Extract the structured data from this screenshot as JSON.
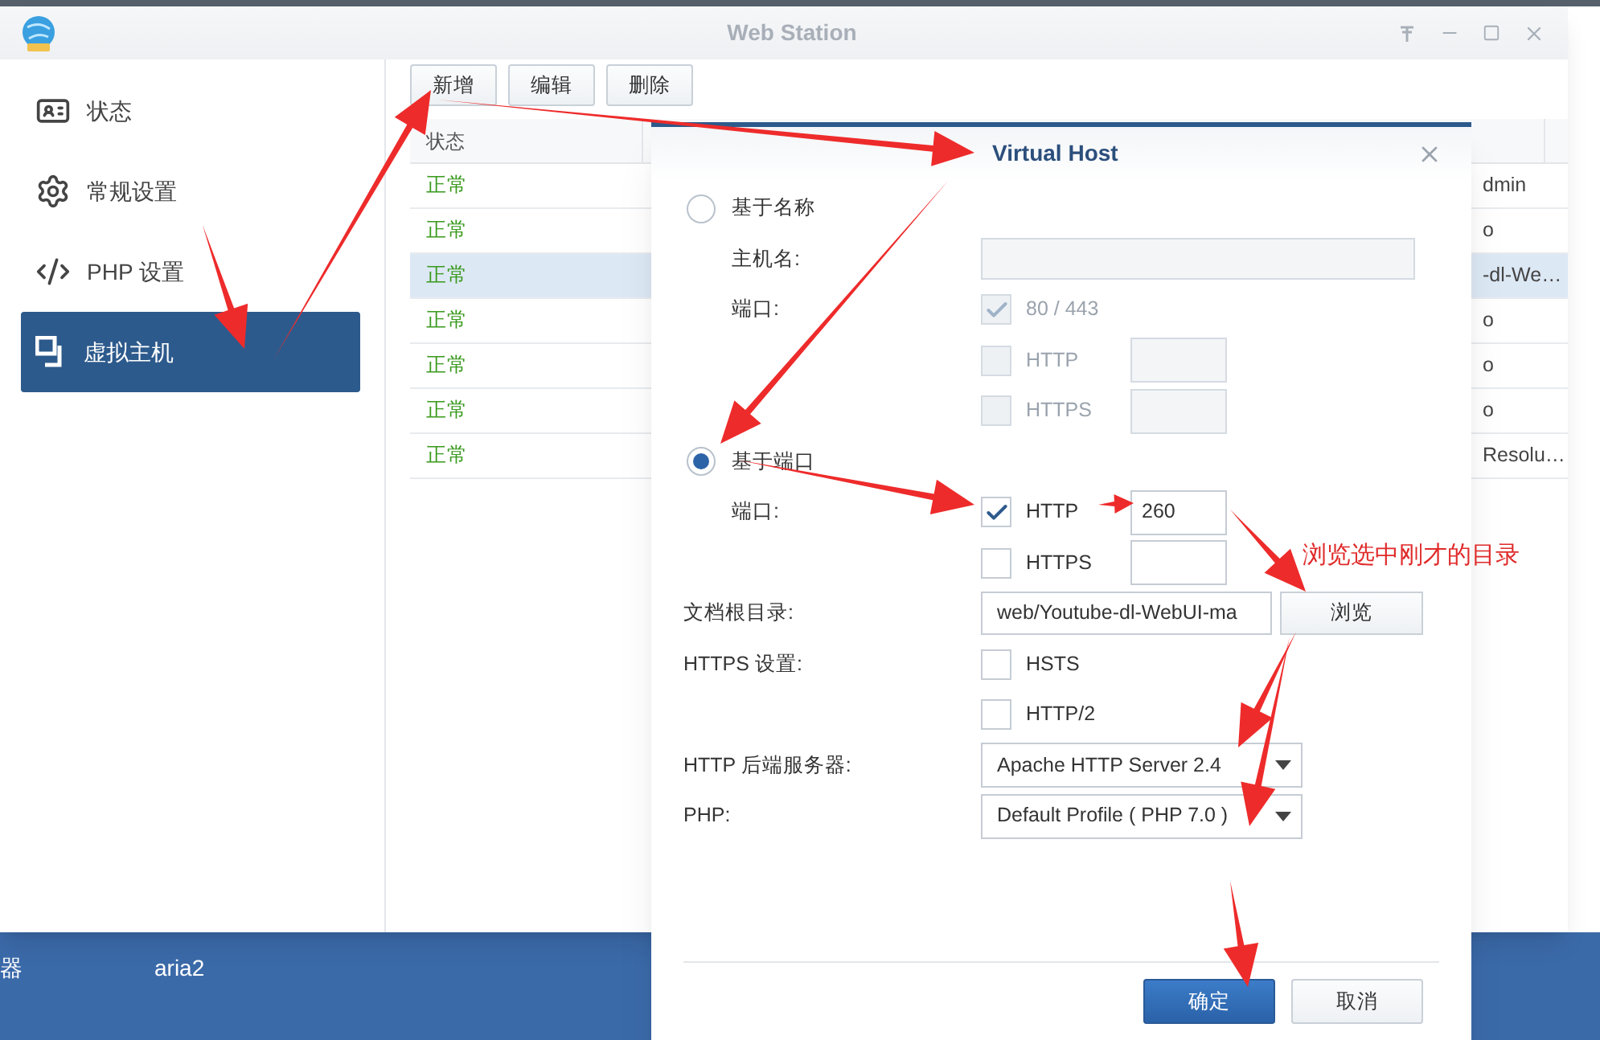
{
  "window": {
    "title": "Web Station"
  },
  "sidebar": {
    "items": [
      {
        "label": "状态",
        "kind": "status",
        "selected": false
      },
      {
        "label": "常规设置",
        "kind": "settings",
        "selected": false
      },
      {
        "label": "PHP 设置",
        "kind": "code",
        "selected": false
      },
      {
        "label": "虚拟主机",
        "kind": "hosts",
        "selected": true
      }
    ]
  },
  "toolbar": {
    "buttons": [
      "新增",
      "编辑",
      "删除"
    ]
  },
  "table": {
    "columns": [
      "状态"
    ],
    "rows": [
      {
        "status": "正常",
        "column_3": "dmin",
        "selected": false
      },
      {
        "status": "正常",
        "column_3": "o",
        "selected": false
      },
      {
        "status": "正常",
        "column_3": "-dl-We…",
        "selected": true
      },
      {
        "status": "正常",
        "column_3": "o",
        "selected": false
      },
      {
        "status": "正常",
        "column_3": "o",
        "selected": false
      },
      {
        "status": "正常",
        "column_3": "o",
        "selected": false
      },
      {
        "status": "正常",
        "column_3": "Resolu…",
        "selected": false
      }
    ]
  },
  "dialog": {
    "title": "Virtual Host",
    "name_based": {
      "label": "基于名称",
      "selected": false,
      "hostname_label": "主机名:",
      "port_label": "端口:",
      "default_port": {
        "label": "80 / 443",
        "checked": true
      },
      "http": {
        "label": "HTTP",
        "checked": false
      },
      "https": {
        "label": "HTTPS",
        "checked": false
      }
    },
    "port_based": {
      "label": "基于端口",
      "selected": true,
      "port_label": "端口:",
      "http": {
        "label": "HTTP",
        "checked": true,
        "value": "260"
      },
      "https": {
        "label": "HTTPS",
        "checked": false
      }
    },
    "document_root": {
      "label": "文档根目录:",
      "value": "web/Youtube-dl-WebUI-ma",
      "button": "浏览"
    },
    "https_settings": {
      "label": "HTTPS 设置:",
      "hsts": {
        "label": "HSTS",
        "checked": false
      },
      "http2": {
        "label": "HTTP/2",
        "checked": false
      }
    },
    "backend": {
      "label": "HTTP 后端服务器:",
      "value": "Apache HTTP Server 2.4"
    },
    "php": {
      "label": "PHP:",
      "value": "Default Profile ( PHP 7.0 )"
    },
    "buttons": [
      {
        "label": "确定",
        "kind": "primary"
      },
      {
        "label": "取消",
        "kind": "secondary"
      }
    ]
  },
  "annotation": "浏览选中刚才的目录",
  "desktop": {
    "labels": [
      "器",
      "aria2"
    ]
  }
}
